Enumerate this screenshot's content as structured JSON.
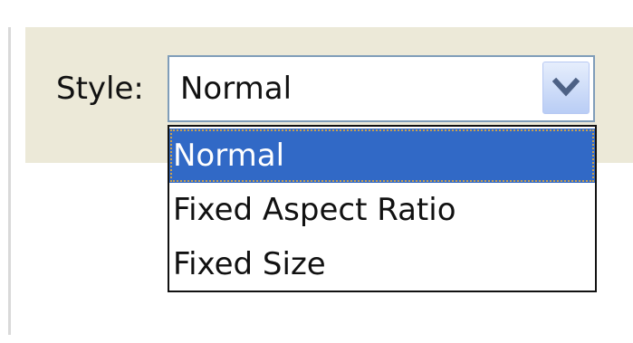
{
  "style_control": {
    "label": "Style:",
    "selected_value": "Normal",
    "options": [
      {
        "label": "Normal",
        "selected": true
      },
      {
        "label": "Fixed Aspect Ratio",
        "selected": false
      },
      {
        "label": "Fixed Size",
        "selected": false
      }
    ]
  },
  "icons": {
    "dropdown_arrow": "chevron-down-icon"
  },
  "colors": {
    "toolbar_background": "#ece9d8",
    "selection_highlight": "#3169c6",
    "select_border": "#7f9db9",
    "arrow_button": "#b9cdf5"
  }
}
